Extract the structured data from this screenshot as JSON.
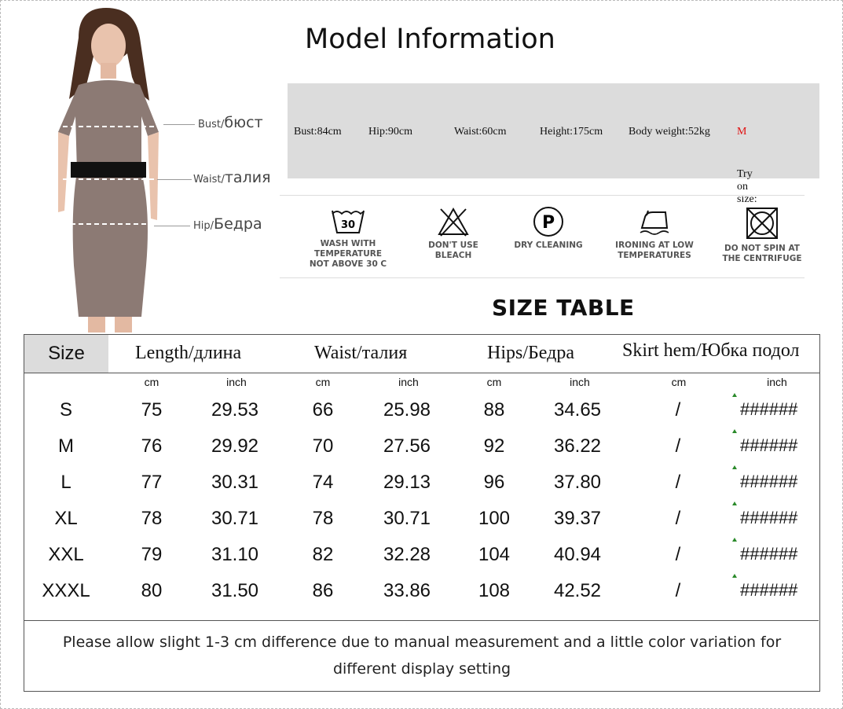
{
  "title": "Model Information",
  "callouts": {
    "bust_en": "Bust/",
    "bust_ru": "бюст",
    "waist_en": "Waist/",
    "waist_ru": "талия",
    "hip_en": "Hip/",
    "hip_ru": "Бедра"
  },
  "model_info": {
    "bust": "Bust:84cm",
    "hip": "Hip:90cm",
    "waist": "Waist:60cm",
    "height": "Height:175cm",
    "weight": "Body weight:52kg",
    "try_label": "Try on size: ",
    "try_value": "M",
    "try_color": "#e01010"
  },
  "care": [
    {
      "icon": "wash-30-icon",
      "label_1": "WASH WITH TEMPERATURE",
      "label_2": "NOT ABOVE 30 C",
      "tub_text": "30"
    },
    {
      "icon": "no-bleach-icon",
      "label_1": "DON'T USE BLEACH",
      "label_2": ""
    },
    {
      "icon": "dry-clean-icon",
      "label_1": "DRY CLEANING",
      "label_2": "",
      "circle_text": "P"
    },
    {
      "icon": "iron-low-icon",
      "label_1": "IRONING AT LOW",
      "label_2": "TEMPERATURES"
    },
    {
      "icon": "no-spin-icon",
      "label_1": "DO NOT SPIN AT",
      "label_2": "THE CENTRIFUGE"
    }
  ],
  "size_table_title": "SIZE TABLE",
  "table": {
    "headers": [
      "Size",
      "Length/длина",
      "Waist/талия",
      "Hips/Бедра",
      "Skirt hem/Юбка подол"
    ],
    "units": [
      "cm",
      "inch",
      "cm",
      "inch",
      "cm",
      "inch",
      "cm",
      "inch"
    ],
    "rows": [
      [
        "S",
        "75",
        "29.53",
        "66",
        "25.98",
        "88",
        "34.65",
        "/",
        "######"
      ],
      [
        "M",
        "76",
        "29.92",
        "70",
        "27.56",
        "92",
        "36.22",
        "/",
        "######"
      ],
      [
        "L",
        "77",
        "30.31",
        "74",
        "29.13",
        "96",
        "37.80",
        "/",
        "######"
      ],
      [
        "XL",
        "78",
        "30.71",
        "78",
        "30.71",
        "100",
        "39.37",
        "/",
        "######"
      ],
      [
        "XXL",
        "79",
        "31.10",
        "82",
        "32.28",
        "104",
        "40.94",
        "/",
        "######"
      ],
      [
        "XXXL",
        "80",
        "31.50",
        "86",
        "33.86",
        "108",
        "42.52",
        "/",
        "######"
      ]
    ]
  },
  "note": "Please allow slight 1-3 cm difference due to manual measurement and a little color variation for different display setting",
  "colors": {
    "dress": "#8c7a74",
    "info_bg": "#dcdcdc",
    "accent_red": "#e01010"
  }
}
